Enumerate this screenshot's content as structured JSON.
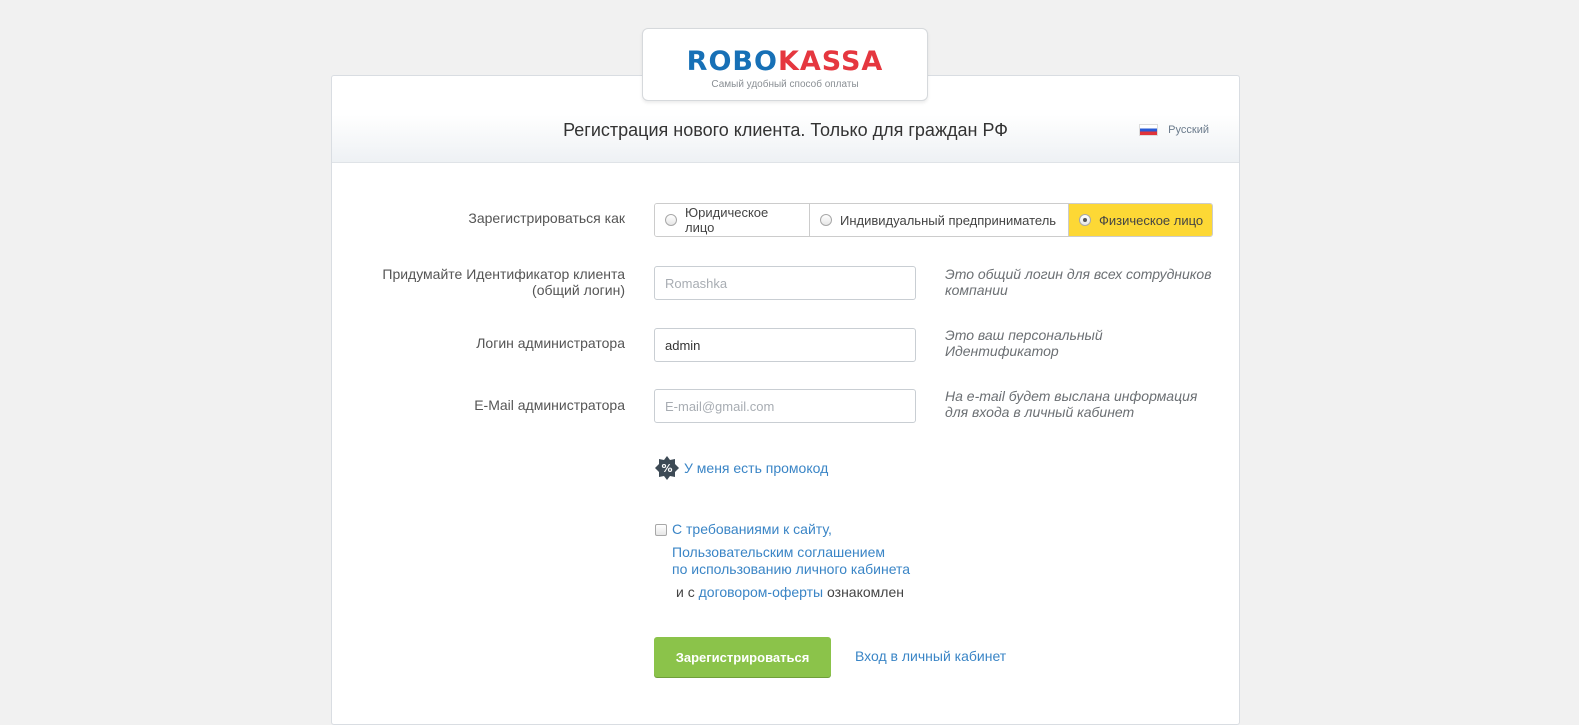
{
  "logo": {
    "part1": "ROBO",
    "part2": "KASSA",
    "tagline": "Самый удобный способ оплаты"
  },
  "header": {
    "title": "Регистрация нового клиента. Только для граждан РФ",
    "language": "Русский"
  },
  "register_as": {
    "label": "Зарегистрироваться как",
    "options": [
      {
        "label": "Юридическое лицо",
        "selected": false
      },
      {
        "label": "Индивидуальный предприниматель",
        "selected": false
      },
      {
        "label": "Физическое лицо",
        "selected": true
      }
    ]
  },
  "client_id": {
    "label_line1": "Придумайте Идентификатор клиента",
    "label_line2": "(общий логин)",
    "value": "",
    "placeholder": "Romashka",
    "hint": "Это общий логин для всех сотрудников компании"
  },
  "admin_login": {
    "label": "Логин администратора",
    "value": "admin",
    "placeholder": "",
    "hint": "Это ваш персональный Идентификатор"
  },
  "admin_email": {
    "label": "E-Mail администратора",
    "value": "",
    "placeholder": "E-mail@gmail.com",
    "hint": "На e-mail будет выслана информация для входа в личный кабинет"
  },
  "promo": {
    "icon": "percent-badge-icon",
    "label": "У меня есть промокод"
  },
  "agreement": {
    "checked": false,
    "link_requirements": "С требованиями к сайту,",
    "link_user_agreement_1": "Пользовательским соглашением",
    "link_user_agreement_2": "по использованию личного кабинета",
    "text_prefix": "и с",
    "link_offer": "договором-оферты",
    "text_suffix": "ознакомлен"
  },
  "actions": {
    "register_label": "Зарегистрироваться",
    "login_link": "Вход в личный кабинет"
  },
  "colors": {
    "accent_yellow": "#fdd835",
    "button_green": "#8bc34a",
    "link_blue": "#3a85c6",
    "logo_blue": "#1770b6",
    "logo_red": "#e5373f"
  }
}
